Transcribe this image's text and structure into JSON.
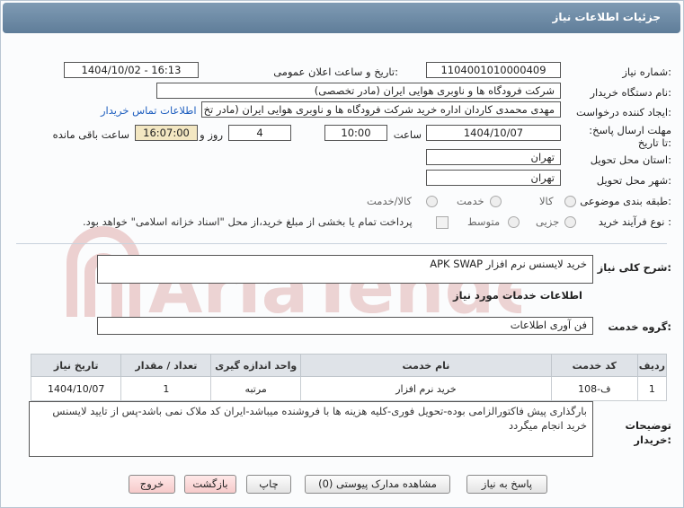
{
  "window": {
    "title": "جزئیات اطلاعات نیاز"
  },
  "labels": {
    "need_number": "شماره نیاز:",
    "announce_date": "تاریخ و ساعت اعلان عمومی:",
    "buyer_org": "نام دستگاه خریدار:",
    "requester": "ایجاد کننده درخواست:",
    "deadline": "مهلت ارسال پاسخ: تا تاریخ:",
    "time_word": "ساعت",
    "day_and": "روز و",
    "remaining": "ساعت باقی مانده",
    "province": "استان محل تحویل:",
    "city": "شهر محل تحویل:",
    "category": "طبقه بندی موضوعی:",
    "purchase_type": "نوع فرآیند خرید :",
    "description": "شرح کلی نیاز:",
    "services_info": "اطلاعات خدمات مورد نیاز",
    "service_group": "گروه خدمت:",
    "buyer_notes": "توضیحات خریدار:"
  },
  "fields": {
    "need_number": "1104001010000409",
    "announce_date": "1404/10/02 - 16:13",
    "buyer_org": "شرکت فرودگاه ها و ناوبری هوایی ایران (مادر تخصصی)",
    "requester": "مهدی محمدی کاردان اداره خرید شرکت فرودگاه ها و ناوبری هوایی ایران (مادر تخ",
    "contact_link": "اطلاعات تماس خریدار",
    "deadline_date": "1404/10/07",
    "deadline_time": "10:00",
    "days": "4",
    "remaining_time": "16:07:00",
    "province": "تهران",
    "city": "تهران",
    "description": "خرید لایسنس نرم افزار APK SWAP",
    "service_group": "فن آوری اطلاعات",
    "buyer_notes": "بارگذاری پیش فاکتورالزامی بوده-تحویل فوری-کلیه هزینه ها با فروشنده میباشد-ایران کد ملاک نمی باشد-پس از تایید لایسنس خرید انجام میگردد"
  },
  "category_options": {
    "goods": "کالا",
    "service": "خدمت",
    "goods_service": "کالا/خدمت"
  },
  "purchase_options": {
    "partial": "جزیی",
    "medium": "متوسط",
    "treasury_note": "پرداخت تمام یا بخشی از مبلغ خرید،از محل \"اسناد خزانه اسلامی\" خواهد بود."
  },
  "table": {
    "headers": [
      "ردیف",
      "کد خدمت",
      "نام خدمت",
      "واحد اندازه گیری",
      "تعداد / مقدار",
      "تاریخ نیاز"
    ],
    "rows": [
      [
        "1",
        "ف-108",
        "خرید نرم افزار",
        "مرتبه",
        "1",
        "1404/10/07"
      ]
    ]
  },
  "buttons": {
    "reply": "پاسخ به نیاز",
    "attachments": "مشاهده مدارک پیوستی (0)",
    "print": "چاپ",
    "back": "بازگشت",
    "exit": "خروج"
  },
  "watermark": {
    "text": "AriaTender.neT"
  },
  "colors": {
    "titlebar": "#6b88a4",
    "link": "#1f5fbf",
    "remaining_bg": "#f3e7c2",
    "watermark": "#e9c9c9"
  }
}
